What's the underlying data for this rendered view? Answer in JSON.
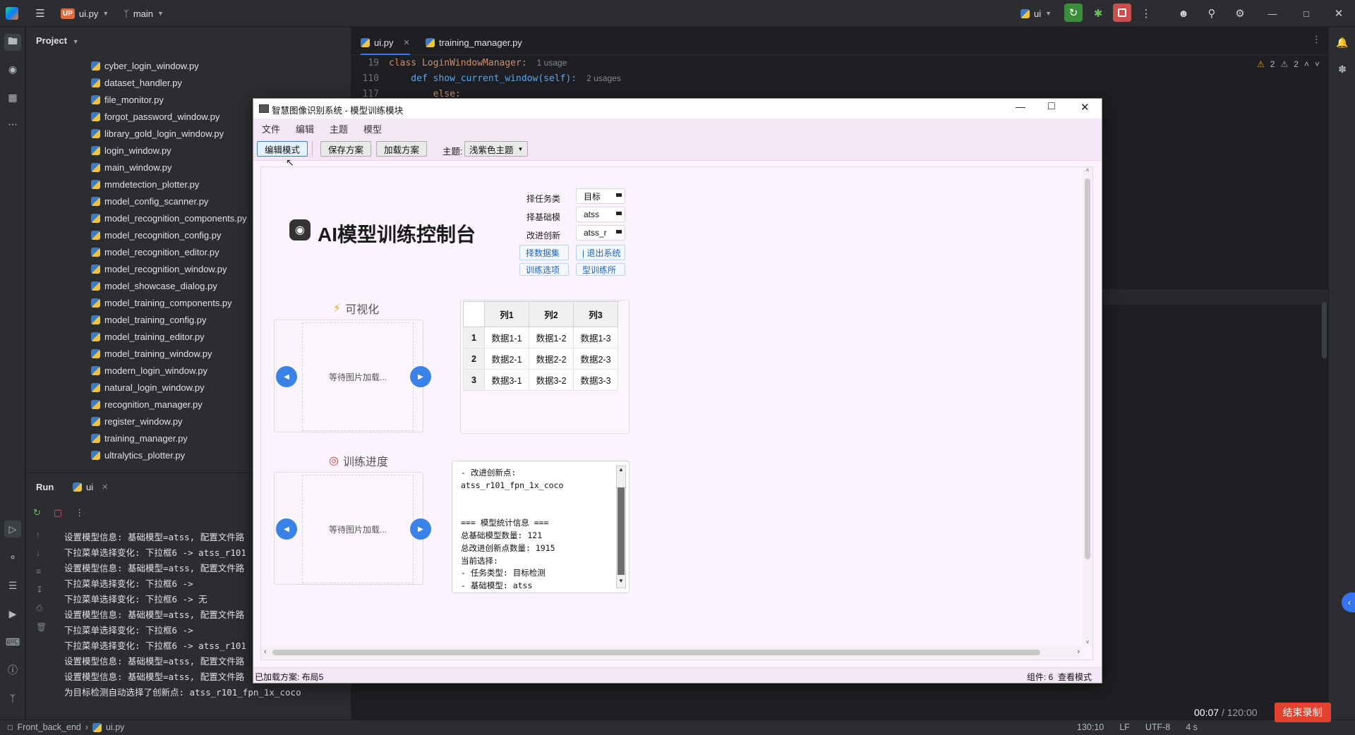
{
  "ide": {
    "project_badge": "UP",
    "project_file": "ui.py",
    "branch": "main",
    "run_config": "ui",
    "project_panel_title": "Project",
    "files": [
      "cyber_login_window.py",
      "dataset_handler.py",
      "file_monitor.py",
      "forgot_password_window.py",
      "library_gold_login_window.py",
      "login_window.py",
      "main_window.py",
      "mmdetection_plotter.py",
      "model_config_scanner.py",
      "model_recognition_components.py",
      "model_recognition_config.py",
      "model_recognition_editor.py",
      "model_recognition_window.py",
      "model_showcase_dialog.py",
      "model_training_components.py",
      "model_training_config.py",
      "model_training_editor.py",
      "model_training_window.py",
      "modern_login_window.py",
      "natural_login_window.py",
      "recognition_manager.py",
      "register_window.py",
      "training_manager.py",
      "ultralytics_plotter.py"
    ],
    "tabs": [
      {
        "label": "ui.py",
        "active": true
      },
      {
        "label": "training_manager.py",
        "active": false
      }
    ],
    "code": [
      {
        "line": "19",
        "text": "class LoginWindowManager:",
        "hint": "1 usage"
      },
      {
        "line": "110",
        "text": "    def show_current_window(self):",
        "hint": "2 usages"
      },
      {
        "line": "117",
        "text": "        else:",
        "hint": ""
      }
    ],
    "inspections": {
      "warnings": "2",
      "weak_warnings": "2"
    },
    "run_panel": {
      "title": "Run",
      "tab": "ui",
      "lines": [
        "设置模型信息: 基础模型=atss, 配置文件路",
        "下拉菜单选择变化: 下拉框6 -> atss_r101",
        "设置模型信息: 基础模型=atss, 配置文件路",
        "下拉菜单选择变化: 下拉框6 ->",
        "下拉菜单选择变化: 下拉框6 -> 无",
        "设置模型信息: 基础模型=atss, 配置文件路",
        "下拉菜单选择变化: 下拉框6 ->",
        "下拉菜单选择变化: 下拉框6 -> atss_r101",
        "设置模型信息: 基础模型=atss, 配置文件路",
        "设置模型信息: 基础模型=atss, 配置文件路",
        "为目标检测自动选择了创新点: atss_r101_fpn_1x_coco"
      ]
    },
    "status": {
      "breadcrumb_root": "Front_back_end",
      "breadcrumb_file": "ui.py",
      "position": "130:10",
      "line_sep": "LF",
      "encoding": "UTF-8",
      "indent": "4 s"
    },
    "recording": {
      "elapsed": "00:07",
      "total": "/ 120:00",
      "stop_label": "结束录制"
    }
  },
  "app": {
    "title": "智慧图像识别系统 - 模型训练模块",
    "menu": [
      "文件",
      "编辑",
      "主题",
      "模型"
    ],
    "toolbar": {
      "edit_mode": "编辑模式",
      "save_plan": "保存方案",
      "load_plan": "加载方案",
      "theme_label": "主题:",
      "theme_value": "浅紫色主题"
    },
    "header_title": "AI模型训练控制台",
    "form": {
      "rows": [
        {
          "label": "择任务类",
          "value": "目标​"
        },
        {
          "label": "择基础模",
          "value": "atss"
        },
        {
          "label": "改进创新",
          "value": "atss_r"
        }
      ],
      "btn_a": "择数据集",
      "btn_b": "| 退出系统",
      "btn_c": "训练选项",
      "btn_d": "型训练所"
    },
    "visual": {
      "title": "可视化",
      "placeholder": "等待图片加载..."
    },
    "progress": {
      "title": "训练进度",
      "placeholder": "等待图片加载..."
    },
    "table": {
      "headers": [
        "列1",
        "列2",
        "列3"
      ],
      "rows": [
        {
          "h": "1",
          "cells": [
            "数据1-1",
            "数据1-2",
            "数据1-3"
          ]
        },
        {
          "h": "2",
          "cells": [
            "数据2-1",
            "数据2-2",
            "数据2-3"
          ]
        },
        {
          "h": "3",
          "cells": [
            "数据3-1",
            "数据3-2",
            "数据3-3"
          ]
        }
      ]
    },
    "log_lines": [
      "- 改进创新点:",
      "atss_r101_fpn_1x_coco",
      "",
      "",
      "=== 模型统计信息 ===",
      "总基础模型数量: 121",
      "总改进创新点数量: 1915",
      "当前选择:",
      "- 任务类型: 目标检测",
      "- 基础模型: atss"
    ],
    "status_left": "已加载方案: 布局5",
    "status_right": "组件: 6  查看模式"
  },
  "colors": {
    "ide_bg": "#1e1f22",
    "ide_panel": "#2b2d30",
    "app_bg": "#fbf3fd",
    "app_menu": "#f4e6f7",
    "accent_blue": "#3b82e6",
    "record_red": "#e5412f"
  }
}
